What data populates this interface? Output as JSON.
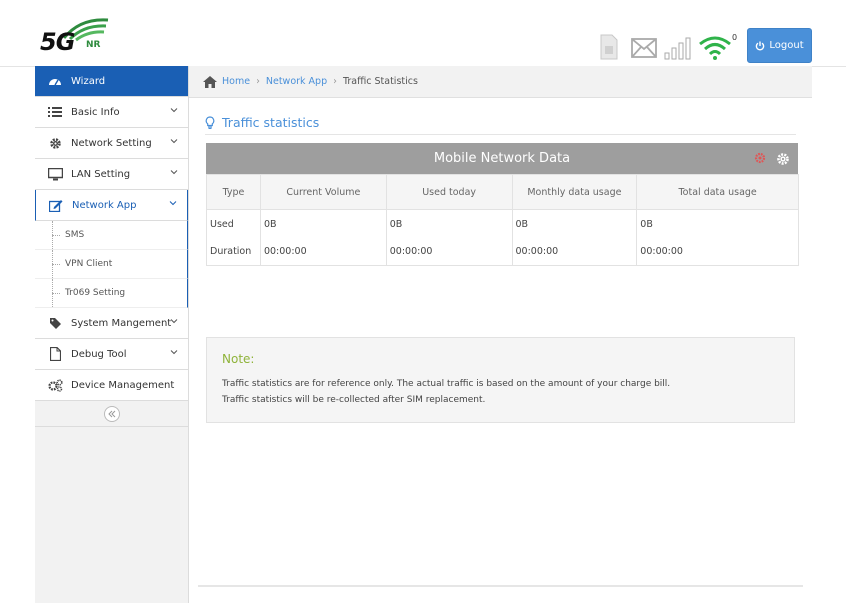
{
  "logo": {
    "main": "5G",
    "sub": "NR"
  },
  "header": {
    "icons": [
      "sim-card-icon",
      "mail-icon",
      "signal-strength-icon",
      "wifi-icon"
    ],
    "wifi_count": "0",
    "logout_label": "Logout"
  },
  "sidebar": {
    "items": [
      {
        "label": "Wizard",
        "icon": "dashboard-icon"
      },
      {
        "label": "Basic Info",
        "icon": "list-icon"
      },
      {
        "label": "Network Setting",
        "icon": "gear-icon"
      },
      {
        "label": "LAN Setting",
        "icon": "monitor-icon"
      },
      {
        "label": "Network App",
        "icon": "edit-icon"
      },
      {
        "label": "System Mangement",
        "icon": "tag-icon"
      },
      {
        "label": "Debug Tool",
        "icon": "file-icon"
      },
      {
        "label": "Device Management",
        "icon": "gears-icon"
      }
    ],
    "subitems": [
      "SMS",
      "VPN Client",
      "Tr069 Setting"
    ]
  },
  "breadcrumb": {
    "home": "Home",
    "section": "Network App",
    "current": "Traffic Statistics"
  },
  "page_title": "Traffic statistics",
  "panel": {
    "title": "Mobile Network Data",
    "columns": [
      "Type",
      "Current Volume",
      "Used today",
      "Monthly data usage",
      "Total data usage"
    ],
    "rows": [
      {
        "type": "Used",
        "current": "0B",
        "today": "0B",
        "monthly": "0B",
        "total": "0B"
      },
      {
        "type": "Duration",
        "current": "00:00:00",
        "today": "00:00:00",
        "monthly": "00:00:00",
        "total": "00:00:00"
      }
    ]
  },
  "note": {
    "title": "Note:",
    "lines": [
      "Traffic statistics are for reference only. The actual traffic is based on the amount of your charge bill.",
      "Traffic statistics will be re-collected after SIM replacement."
    ]
  },
  "colors": {
    "accent": "#1a5fb4",
    "link": "#4a90d9",
    "note_title": "#8fb33a",
    "panel_head": "#9e9e9e",
    "wifi": "#2fb34a"
  }
}
